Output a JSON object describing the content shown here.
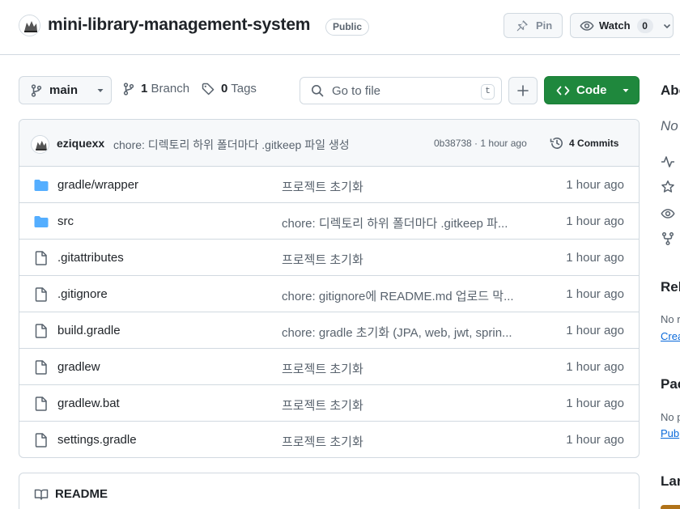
{
  "repo": {
    "name": "mini-library-management-system",
    "visibility": "Public",
    "pin_label": "Pin",
    "watch_label": "Watch",
    "watch_count": "0"
  },
  "toolbar": {
    "branch": "main",
    "branch_count": "1",
    "branch_label": "Branch",
    "tag_count": "0",
    "tag_label": "Tags",
    "search_placeholder": "Go to file",
    "search_shortcut": "t",
    "code_label": "Code",
    "code_color": "#1f883d"
  },
  "latest_commit": {
    "author": "eziquexx",
    "message": "chore: 디렉토리 하위 폴더마다 .gitkeep 파일 생성",
    "hash": "0b38738",
    "separator": " · ",
    "time": "1 hour ago",
    "commits_count": "4",
    "commits_label": "Commits"
  },
  "files": [
    {
      "icon": "folder-icon",
      "name": "gradle/wrapper",
      "message": "프로젝트 초기화",
      "time": "1 hour ago"
    },
    {
      "icon": "folder-icon",
      "name": "src",
      "message": "chore: 디렉토리 하위 폴더마다 .gitkeep 파...",
      "time": "1 hour ago"
    },
    {
      "icon": "file-icon",
      "name": ".gitattributes",
      "message": "프로젝트 초기화",
      "time": "1 hour ago"
    },
    {
      "icon": "file-icon",
      "name": ".gitignore",
      "message": "chore: gitignore에 README.md 업로드 막...",
      "time": "1 hour ago"
    },
    {
      "icon": "file-icon",
      "name": "build.gradle",
      "message": "chore: gradle 초기화 (JPA, web, jwt, sprin...",
      "time": "1 hour ago"
    },
    {
      "icon": "file-icon",
      "name": "gradlew",
      "message": "프로젝트 초기화",
      "time": "1 hour ago"
    },
    {
      "icon": "file-icon",
      "name": "gradlew.bat",
      "message": "프로젝트 초기화",
      "time": "1 hour ago"
    },
    {
      "icon": "file-icon",
      "name": "settings.gradle",
      "message": "프로젝트 초기화",
      "time": "1 hour ago"
    }
  ],
  "readme": {
    "label": "README"
  },
  "sidebar": {
    "about_heading": "Abo",
    "about_description": "No",
    "releases_heading": "Rel",
    "releases_text": "No r",
    "releases_link": "Crea",
    "packages_heading": "Pac",
    "packages_text": "No p",
    "packages_link": "Pub",
    "languages_heading": "Lan",
    "language_color": "#b07219"
  }
}
